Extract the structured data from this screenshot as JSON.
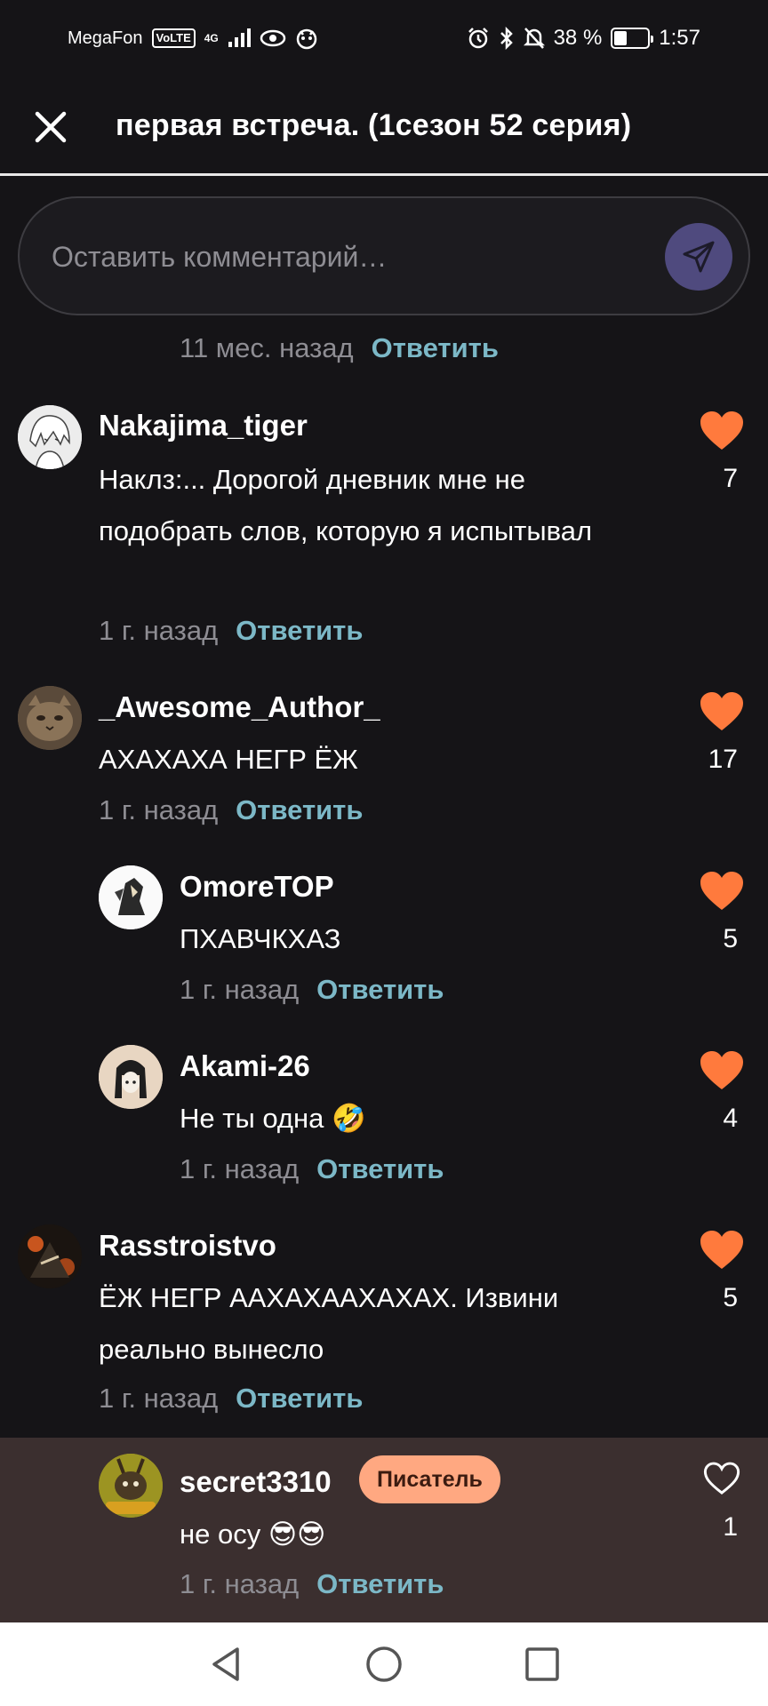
{
  "status_bar": {
    "carrier": "MegaFon",
    "volte": "VoLTE",
    "network": "4G",
    "battery": "38 %",
    "battery_level": 0.38,
    "time": "1:57"
  },
  "header": {
    "title": "первая встреча. (1сезон 52 серия)"
  },
  "comment_box": {
    "placeholder": "Оставить комментарий…"
  },
  "partial_comment": {
    "time": "11 мес. назад",
    "reply": "Ответить"
  },
  "comments": [
    {
      "author": "Nakajima_tiger",
      "text": "Наклз:... Дорогой дневник мне не подобрать слов, которую я испытывал",
      "time": "1 г. назад",
      "reply": "Ответить",
      "likes": "7",
      "liked": true
    },
    {
      "author": "_Awesome_Author_",
      "text": "АХАХАХА НЕГР ЁЖ",
      "time": "1 г. назад",
      "reply": "Ответить",
      "likes": "17",
      "liked": true
    },
    {
      "author": "OmoreTOP",
      "text": "ПХАВЧКХАЗ",
      "time": "1 г. назад",
      "reply": "Ответить",
      "likes": "5",
      "liked": true
    },
    {
      "author": "Akami-26",
      "text": "Не ты одна 🤣",
      "time": "1 г. назад",
      "reply": "Ответить",
      "likes": "4",
      "liked": true
    },
    {
      "author": "Rasstroistvo",
      "text": "ЁЖ НЕГР ААХАХААХАХАХ. Извини реально вынесло",
      "time": "1 г. назад",
      "reply": "Ответить",
      "likes": "5",
      "liked": true
    },
    {
      "author": "secret3310",
      "badge": "Писатель",
      "text": "не осу 😎😎",
      "time": "1 г. назад",
      "reply": "Ответить",
      "likes": "1",
      "liked": false
    }
  ],
  "colors": {
    "background": "#151417",
    "accent_reply": "#7cb8c7",
    "like": "#ff7a3d",
    "send_button": "#4f4a7e",
    "badge": "#ffa881",
    "highlight_row": "#3b2f2f"
  }
}
